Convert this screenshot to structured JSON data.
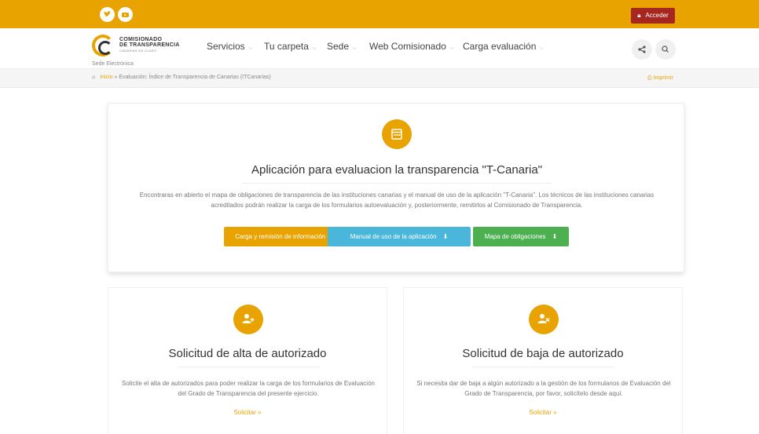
{
  "topbar": {
    "social": [
      {
        "icon": "twitter-icon",
        "glyph": "✔"
      },
      {
        "icon": "youtube-icon",
        "glyph": "▶"
      }
    ],
    "login_label": "Acceder",
    "login_icon": "lock-icon",
    "background": "#e8a300"
  },
  "header": {
    "logo_line1": "COMISIONADO",
    "logo_line2": "DE TRANSPARENCIA",
    "logo_line3": "CANARIAS EN CLARO",
    "sede": "Sede Electrónica",
    "nav": [
      {
        "label": "Servicios"
      },
      {
        "label": "Tu carpeta"
      },
      {
        "label": "Sede"
      },
      {
        "label": "Web Comisionado"
      },
      {
        "label": "Carga evaluación"
      }
    ],
    "share_icon": "share-icon",
    "search_icon": "search-icon"
  },
  "breadcrumb": {
    "home_icon": "home-icon",
    "inicio": "Inicio",
    "separator": "»",
    "current": "Evaluación: Índice de Transparencia de Canarias (ITCanarias)",
    "print_label": "Imprimir",
    "print_icon": "print-icon"
  },
  "main_card": {
    "icon": "calendar-icon",
    "title": "Aplicación para evaluacion la transparencia \"T-Canaria\"",
    "description": "Encontraras en abierto el mapa de obligaciones de transparencia de las instituciones canarias y el manual de uso de la aplicación \"T-Canaria\". Los técnicos de las instituciones canarias acreditados podrán realizar la carga de los formularios autoevaluación y, posteriormente, remitirlos al Comisionado de Transparencia.",
    "buttons": [
      {
        "label": "Carga y remisión de información",
        "icon": "»",
        "color": "#e8a300"
      },
      {
        "label": "Manual de uso de la aplicación",
        "icon": "⬇",
        "color": "#4ab6d9"
      },
      {
        "label": "Mapa de obligaciones",
        "icon": "⬇",
        "color": "#4caf50"
      }
    ]
  },
  "cards": [
    {
      "icon": "user-add-icon",
      "title": "Solicitud de alta de autorizado",
      "description": "Solicite el alta de autorizados para poder realizar la carga de los formularios de Evaluación del Grado de Transparencia del presente ejercicio.",
      "link": "Solicitar »"
    },
    {
      "icon": "user-remove-icon",
      "title": "Solicitud de baja de autorizado",
      "description": "Si necesita dar de baja a algún autorizado a la gestión de los formularios de Evaluación del Grado de Transparencia, por favor, solicítelo desde aquí.",
      "link": "Solicitar »"
    }
  ]
}
